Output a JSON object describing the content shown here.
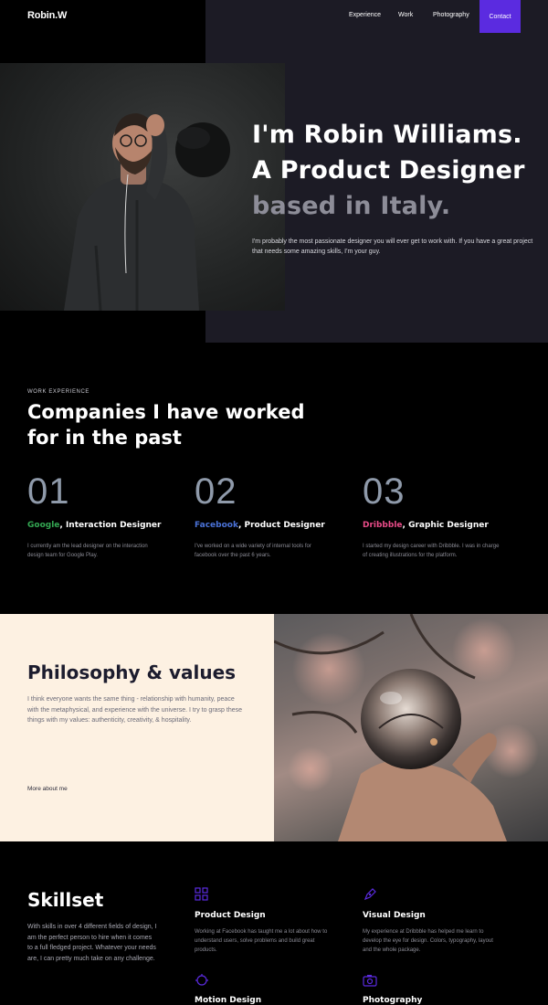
{
  "nav": {
    "logo": "Robin.W",
    "links": [
      "Experience",
      "Work",
      "Photography"
    ],
    "contact": "Contact"
  },
  "hero": {
    "title_line1": "I'm Robin Williams.",
    "title_line2": "A Product Designer",
    "title_line3": "based in Italy.",
    "description": "I'm probably the most passionate designer you will ever get to work with. If you have a great project that needs some amazing skills, I'm your guy.",
    "photo_icon": "portrait-photo"
  },
  "work": {
    "eyebrow": "WORK EXPERIENCE",
    "title_line1": "Companies I have worked",
    "title_line2": "for in the past",
    "items": [
      {
        "number": "01",
        "company": "Google",
        "role": ", Interaction Designer",
        "company_color": "#34a853",
        "description": "I currently am the lead designer on the interaction design team for Google Play."
      },
      {
        "number": "02",
        "company": "Facebook",
        "role": ", Product Designer",
        "company_color": "#4a72d8",
        "description": "I've worked on a wide variety of internal tools for facebook over the past 6 years."
      },
      {
        "number": "03",
        "company": "Dribbble",
        "role": ", Graphic Designer",
        "company_color": "#ea4c89",
        "description": "I started my design career with Dribbble. I was in charge of creating illustrations for the platform."
      }
    ]
  },
  "philosophy": {
    "title": "Philosophy & values",
    "description": "I think everyone wants the same thing - relationship with humanity, peace with the metaphysical, and experience with the universe. I try to grasp these things with my values: authenticity, creativity, & hospitality.",
    "link": "More about me",
    "photo_icon": "crystal-ball-photo"
  },
  "skills": {
    "title": "Skillset",
    "intro": "With skills in over 4 different fields of design, I am the perfect person to hire when it comes to a full fledged project. Whatever your needs are, I can pretty much take on any challenge.",
    "items": [
      {
        "name": "Product Design",
        "description": "Working at Facebook has taught me a lot about how to understand users, solve problems and build great products.",
        "icon": "grid-icon"
      },
      {
        "name": "Visual Design",
        "description": "My experience at Dribbble has helped me learn to develop the eye for design. Colors, typography, layout and the whole package.",
        "icon": "pen-icon"
      },
      {
        "name": "Motion Design",
        "description": "",
        "icon": "motion-icon"
      },
      {
        "name": "Photography",
        "description": "",
        "icon": "camera-icon"
      }
    ]
  },
  "colors": {
    "accent": "#5b2be0",
    "hero_panel": "#1c1b25",
    "cream": "#fdf1e2"
  }
}
